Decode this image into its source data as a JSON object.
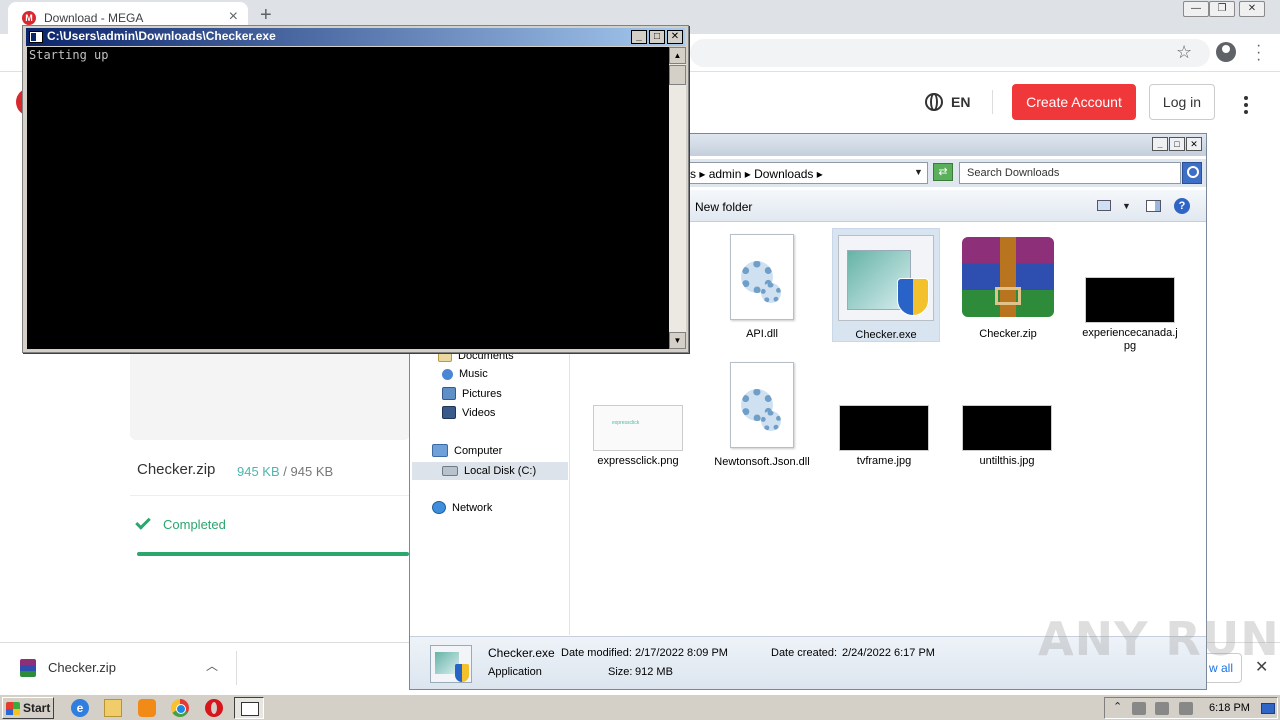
{
  "browser": {
    "tab_title": "Download - MEGA",
    "tab_close": "×",
    "new_tab": "+",
    "win_min": "—",
    "win_restore": "❐",
    "win_close": "✕",
    "favicon": "M",
    "star": "☆"
  },
  "mega": {
    "language": "EN",
    "create_account": "Create Account",
    "login": "Log in",
    "file_name": "Checker.zip",
    "downloaded": "945 KB",
    "size_separator": "/",
    "total": "945 KB",
    "status": "Completed",
    "progress_fraction": 1.0,
    "accent": "#2ba66d",
    "brand": "#d9272e"
  },
  "download_shelf": {
    "file": "Checker.zip",
    "chevron": "︿",
    "show_all": "w all",
    "close": "✕"
  },
  "explorer": {
    "breadcrumb": "rs ▸ admin ▸ Downloads ▸",
    "address_dropdown": "▼",
    "search_placeholder": "Search Downloads",
    "new_folder": "New folder",
    "views_dropdown": "▼",
    "help": "?",
    "refresh": "⇄",
    "btn_min": "_",
    "btn_max": "□",
    "btn_close": "✕",
    "nav": [
      {
        "label": "Documents",
        "icon": "documents-icon"
      },
      {
        "label": "Music",
        "icon": "music-icon"
      },
      {
        "label": "Pictures",
        "icon": "pictures-icon"
      },
      {
        "label": "Videos",
        "icon": "videos-icon"
      },
      {
        "label": "Computer",
        "icon": "computer-icon"
      },
      {
        "label": "Local Disk (C:)",
        "icon": "disk-icon"
      },
      {
        "label": "Network",
        "icon": "network-icon"
      }
    ],
    "files": [
      {
        "name": "API.dll",
        "icon": "dll-file-icon"
      },
      {
        "name": "Checker.exe",
        "icon": "exe-file-icon"
      },
      {
        "name": "Checker.zip",
        "icon": "winrar-archive-icon"
      },
      {
        "name": "experiencecanada.jpg",
        "icon": "image-thumbnail"
      },
      {
        "name": "expressclick.png",
        "icon": "image-thumbnail",
        "thumb_text": "expressclick"
      },
      {
        "name": "Newtonsoft.Json.dll",
        "icon": "dll-file-icon"
      },
      {
        "name": "tvframe.jpg",
        "icon": "image-thumbnail"
      },
      {
        "name": "untilthis.jpg",
        "icon": "image-thumbnail"
      }
    ],
    "details": {
      "name": "Checker.exe",
      "type": "Application",
      "modified_label": "Date modified:",
      "modified": "2/17/2022 8:09 PM",
      "created_label": "Date created:",
      "created": "2/24/2022 6:17 PM",
      "size_label": "Size:",
      "size": "912 MB"
    }
  },
  "console": {
    "title": "C:\\Users\\admin\\Downloads\\Checker.exe",
    "output": "Starting up",
    "btn_min": "_",
    "btn_max": "□",
    "btn_close": "✕",
    "scroll_up": "▲",
    "scroll_down": "▼"
  },
  "taskbar": {
    "start": "Start",
    "ie": "e",
    "tray_arrow": "⌃",
    "clock": "6:18 PM"
  },
  "watermark": "ANY RUN"
}
